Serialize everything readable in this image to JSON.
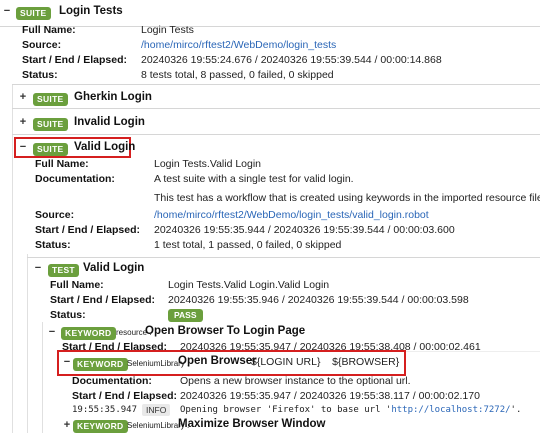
{
  "suite_root": {
    "badge": "SUITE",
    "name": "Login Tests",
    "full_name_label": "Full Name:",
    "full_name": "Login Tests",
    "source_label": "Source:",
    "source": "/home/mirco/rftest2/WebDemo/login_tests",
    "times_label": "Start / End / Elapsed:",
    "times": "20240326 19:55:24.676 / 20240326 19:55:39.544 / 00:00:14.868",
    "status_label": "Status:",
    "status": "8 tests total, 8 passed, 0 failed, 0 skipped"
  },
  "child_suites": [
    {
      "toggle": "+",
      "badge": "SUITE",
      "name": "Gherkin Login"
    },
    {
      "toggle": "+",
      "badge": "SUITE",
      "name": "Invalid Login"
    }
  ],
  "valid_suite": {
    "toggle": "−",
    "badge": "SUITE",
    "name": "Valid Login",
    "full_name_label": "Full Name:",
    "full_name": "Login Tests.Valid Login",
    "doc_label": "Documentation:",
    "doc_line1": "A test suite with a single test for valid login.",
    "doc_line2": "This test has a workflow that is created using keywords in the imported resource file.",
    "source_label": "Source:",
    "source": "/home/mirco/rftest2/WebDemo/login_tests/valid_login.robot",
    "times_label": "Start / End / Elapsed:",
    "times": "20240326 19:55:35.944 / 20240326 19:55:39.544 / 00:00:03.600",
    "status_label": "Status:",
    "status": "1 test total, 1 passed, 0 failed, 0 skipped"
  },
  "test": {
    "toggle": "−",
    "badge": "TEST",
    "name": "Valid Login",
    "full_name_label": "Full Name:",
    "full_name": "Login Tests.Valid Login.Valid Login",
    "times_label": "Start / End / Elapsed:",
    "times": "20240326 19:55:35.946 / 20240326 19:55:39.544 / 00:00:03.598",
    "status_label": "Status:",
    "status": "PASS"
  },
  "kw1": {
    "toggle": "−",
    "badge": "KEYWORD",
    "lib": "resource .",
    "name": "Open Browser To Login Page",
    "times_label": "Start / End / Elapsed:",
    "times": "20240326 19:55:35.947 / 20240326 19:55:38.408 / 00:00:02.461"
  },
  "kw2": {
    "toggle": "−",
    "badge": "KEYWORD",
    "lib": "SeleniumLibrary .",
    "name": "Open Browser",
    "args": "${LOGIN URL}    ${BROWSER}",
    "doc_label": "Documentation:",
    "doc": "Opens a new browser instance to the optional url.",
    "times_label": "Start / End / Elapsed:",
    "times": "20240326 19:55:35.947 / 20240326 19:55:38.117 / 00:00:02.170",
    "log_time": "19:55:35.947",
    "log_level": "INFO",
    "log_msg_pre": "Opening browser 'Firefox' to base url '",
    "log_url": "http://localhost:7272/",
    "log_msg_post": "'."
  },
  "kw3": {
    "toggle": "+",
    "badge": "KEYWORD",
    "lib": "SeleniumLibrary .",
    "name": "Maximize Browser Window"
  }
}
